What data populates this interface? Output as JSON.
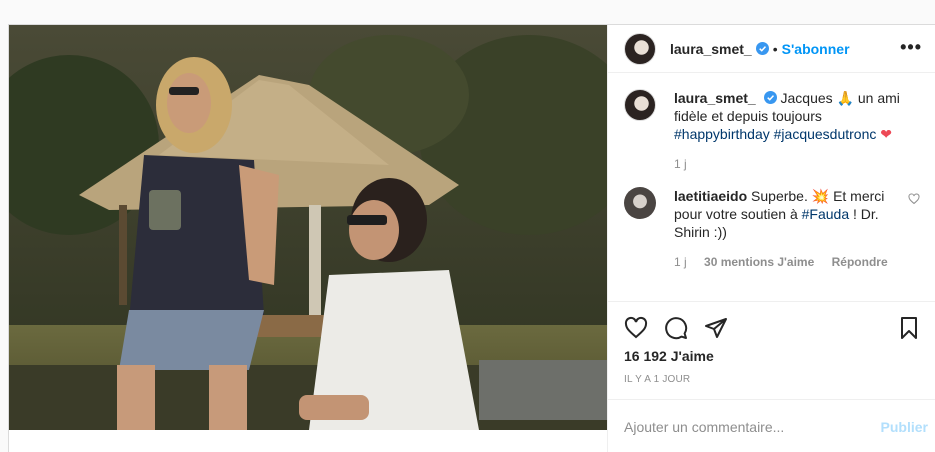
{
  "header": {
    "username": "laura_smet_",
    "separator": "•",
    "follow_label": "S'abonner",
    "more_label": "•••"
  },
  "caption": {
    "username": "laura_smet_",
    "text_before": "Jacques 🙏 un ami fidèle et depuis toujours",
    "hashtag1": "#happybirthday",
    "hashtag2": "#jacquesdutronc",
    "emoji_end": "❤",
    "time": "1 j"
  },
  "comment": {
    "username": "laetitiaeido",
    "text_start": "Superbe. 💥 Et merci pour votre soutien à",
    "hashtag": "#Fauda",
    "text_end": "! Dr. Shirin :))",
    "time": "1 j",
    "likes_label": "30 mentions J'aime",
    "reply_label": "Répondre"
  },
  "actions": {
    "like_icon": "heart-outline-icon",
    "comment_icon": "comment-bubble-icon",
    "share_icon": "paper-plane-icon",
    "save_icon": "bookmark-icon"
  },
  "likes": "16 192 J'aime",
  "timestamp": "IL Y A 1 JOUR",
  "add_comment": {
    "placeholder": "Ajouter un commentaire...",
    "publish_label": "Publier"
  },
  "colors": {
    "accent": "#0095f6",
    "hashtag": "#00376b",
    "muted": "#8e8e8e",
    "publish_disabled": "#b2dffc",
    "heart": "#ed4956"
  }
}
